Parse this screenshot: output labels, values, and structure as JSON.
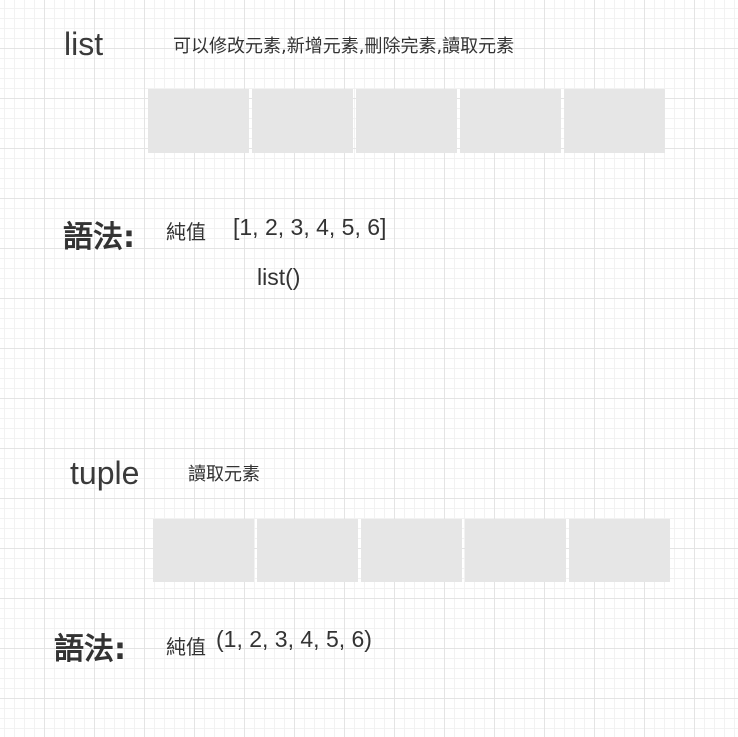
{
  "list": {
    "title": "list",
    "description": "可以修改元素,新增元素,刪除完素,讀取元素",
    "cells": [
      "",
      "",
      "",
      "",
      ""
    ],
    "syntax_label": "語法:",
    "syntax_kind": "純值",
    "syntax_example": "[1, 2, 3, 4, 5, 6]",
    "syntax_constructor": "list()"
  },
  "tuple": {
    "title": "tuple",
    "description": "讀取元素",
    "cells": [
      "",
      "",
      "",
      "",
      ""
    ],
    "syntax_label": "語法:",
    "syntax_kind": "純值",
    "syntax_example": "(1, 2, 3, 4, 5, 6)"
  },
  "colors": {
    "cell_fill": "#e6e6e6",
    "grid_major": "#e4e4e4",
    "grid_minor": "#f2f2f2",
    "text": "#333333"
  }
}
